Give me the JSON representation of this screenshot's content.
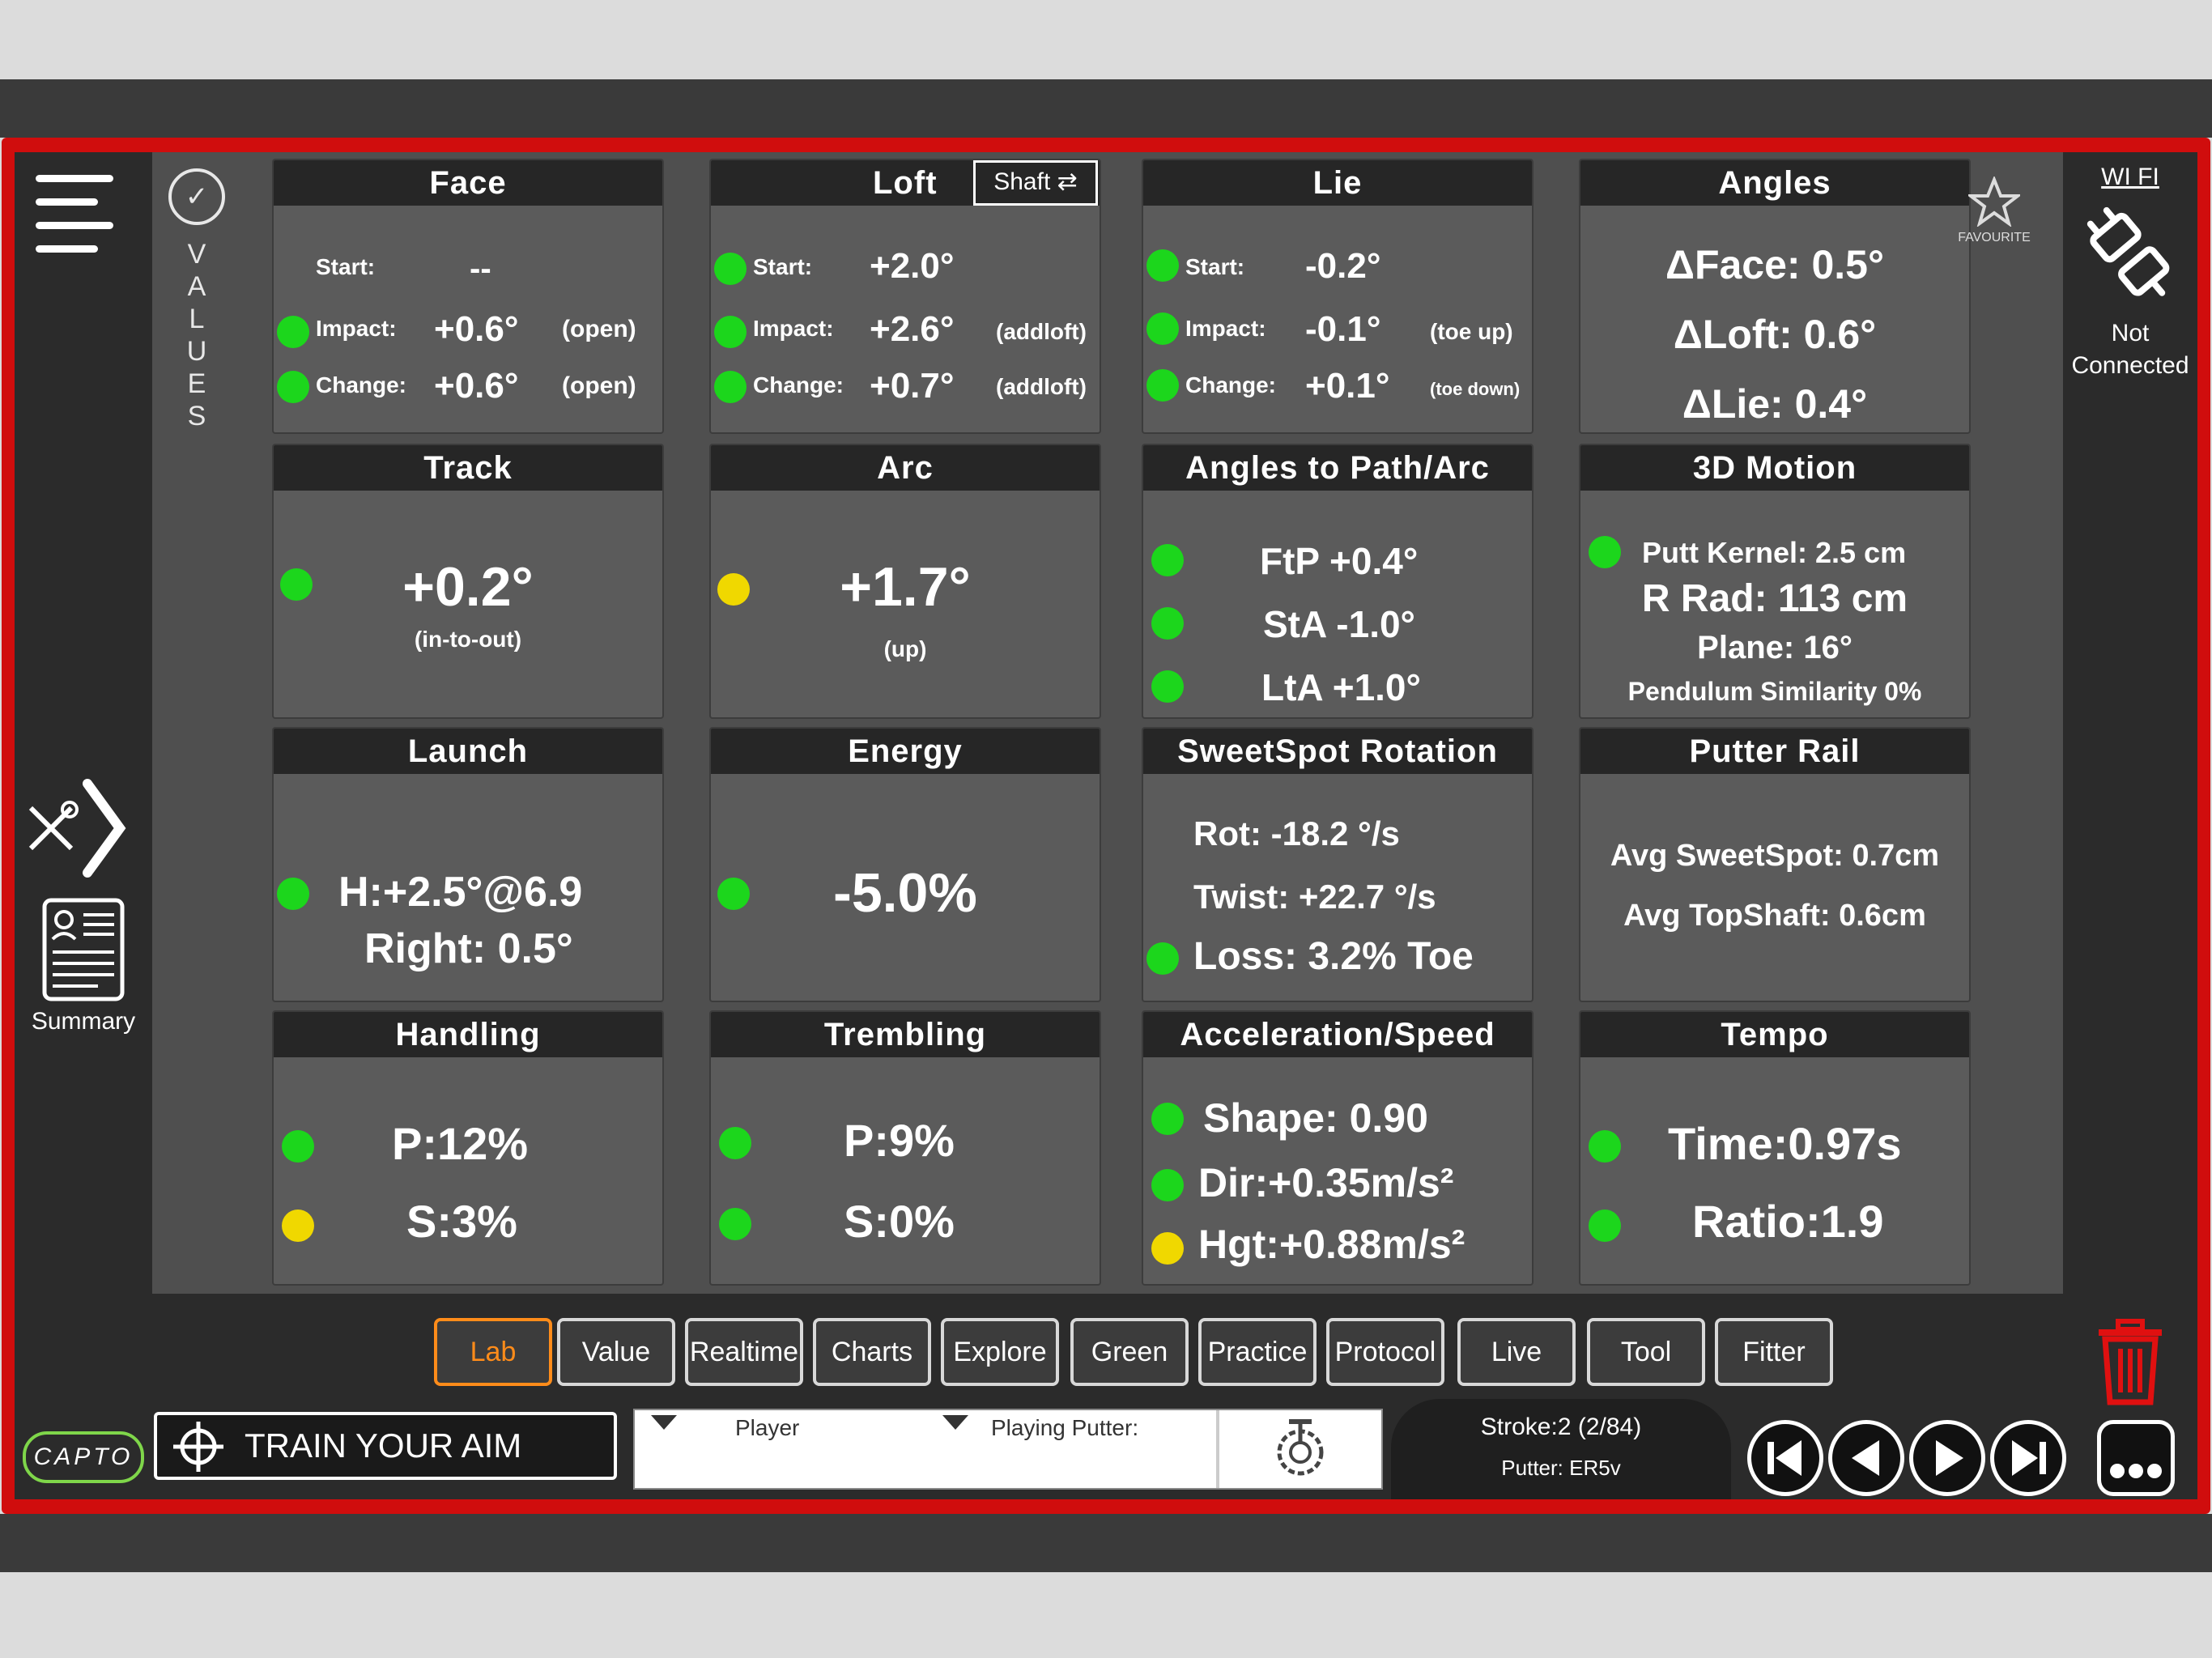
{
  "sidebar": {
    "values_tab": "VALUES",
    "summary_label": "Summary"
  },
  "right": {
    "wifi_label": "WI FI",
    "favourite_label": "FAVOURITE",
    "connection_status_1": "Not",
    "connection_status_2": "Connected"
  },
  "panels": {
    "face": {
      "title": "Face",
      "start_label": "Start:",
      "start_value": "--",
      "impact_label": "Impact:",
      "impact_value": "+0.6°",
      "impact_note": "(open)",
      "change_label": "Change:",
      "change_value": "+0.6°",
      "change_note": "(open)"
    },
    "loft": {
      "title": "Loft",
      "shaft_button": "Shaft ⇄",
      "start_label": "Start:",
      "start_value": "+2.0°",
      "impact_label": "Impact:",
      "impact_value": "+2.6°",
      "impact_note": "(addloft)",
      "change_label": "Change:",
      "change_value": "+0.7°",
      "change_note": "(addloft)"
    },
    "lie": {
      "title": "Lie",
      "start_label": "Start:",
      "start_value": "-0.2°",
      "impact_label": "Impact:",
      "impact_value": "-0.1°",
      "impact_note": "(toe up)",
      "change_label": "Change:",
      "change_value": "+0.1°",
      "change_note": "(toe down)"
    },
    "angles": {
      "title": "Angles",
      "line1": "ΔFace: 0.5°",
      "line2": "ΔLoft: 0.6°",
      "line3": "ΔLie: 0.4°"
    },
    "track": {
      "title": "Track",
      "value": "+0.2°",
      "note": "(in-to-out)"
    },
    "arc": {
      "title": "Arc",
      "value": "+1.7°",
      "note": "(up)"
    },
    "angles_path": {
      "title": "Angles to Path/Arc",
      "line1": "FtP +0.4°",
      "line2": "StA -1.0°",
      "line3": "LtA +1.0°"
    },
    "motion3d": {
      "title": "3D Motion",
      "line1": "Putt Kernel: 2.5 cm",
      "line2": "R Rad: 113 cm",
      "line3": "Plane: 16°",
      "line4": "Pendulum Similarity 0%"
    },
    "launch": {
      "title": "Launch",
      "line1": "H:+2.5°@6.9",
      "line2": "Right: 0.5°"
    },
    "energy": {
      "title": "Energy",
      "value": "-5.0%"
    },
    "sweetspot": {
      "title": "SweetSpot Rotation",
      "line1": "Rot: -18.2 °/s",
      "line2": "Twist: +22.7 °/s",
      "line3": "Loss: 3.2% Toe"
    },
    "putter_rail": {
      "title": "Putter Rail",
      "line1": "Avg SweetSpot: 0.7cm",
      "line2": "Avg TopShaft: 0.6cm"
    },
    "handling": {
      "title": "Handling",
      "line1": "P:12%",
      "line2": "S:3%"
    },
    "trembling": {
      "title": "Trembling",
      "line1": "P:9%",
      "line2": "S:0%"
    },
    "accel": {
      "title": "Acceleration/Speed",
      "line1": "Shape: 0.90",
      "line2": "Dir:+0.35m/s²",
      "line3": "Hgt:+0.88m/s²"
    },
    "tempo": {
      "title": "Tempo",
      "line1": "Time:0.97s",
      "line2": "Ratio:1.9"
    }
  },
  "tabs": [
    "Lab",
    "Value",
    "Realtime",
    "Charts",
    "Explore",
    "Green",
    "Practice",
    "Protocol",
    "Live",
    "Tool",
    "Fitter"
  ],
  "active_tab": "Lab",
  "bottom": {
    "brand": "CAPTO",
    "train_button": "TRAIN YOUR AIM",
    "player_label": "Player",
    "putter_label": "Playing Putter:",
    "stroke": "Stroke:2 (2/84)",
    "putter": "Putter: ER5v"
  },
  "colors": {
    "frame": "#d00d0d",
    "green": "#1cd61c",
    "yellow": "#f0d800",
    "accent": "#ff8c1a"
  }
}
